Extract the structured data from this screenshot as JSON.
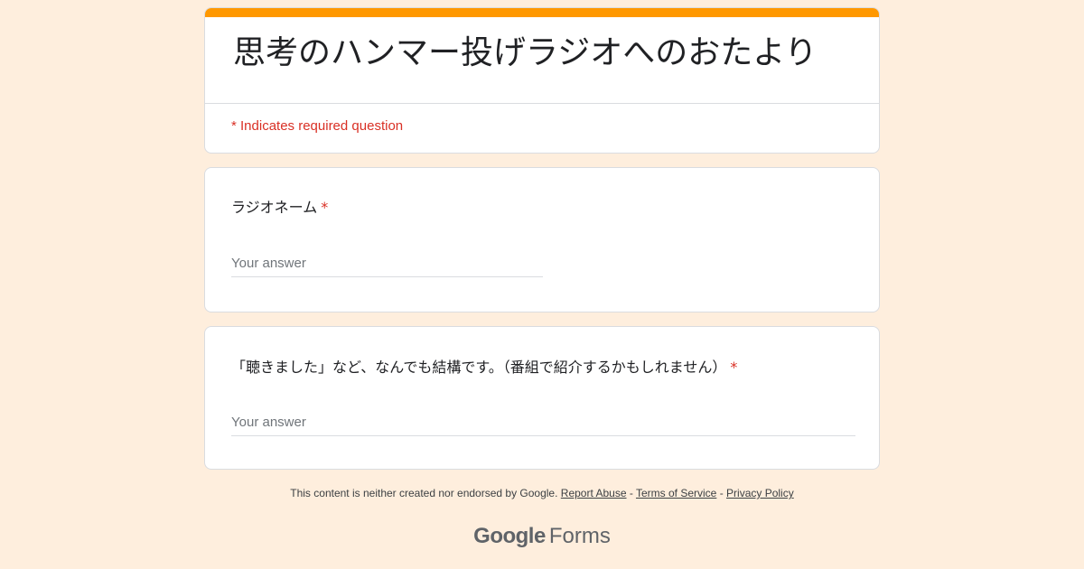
{
  "header": {
    "title": "思考のハンマー投げラジオへのおたより",
    "required_note": "* Indicates required question",
    "accent_color": "#ff9800"
  },
  "questions": [
    {
      "label": "ラジオネーム",
      "required_mark": "*",
      "placeholder": "Your answer",
      "value": ""
    },
    {
      "label": "「聴きました」など、なんでも結構です。（番組で紹介するかもしれません）",
      "required_mark": "*",
      "placeholder": "Your answer",
      "value": ""
    }
  ],
  "footer": {
    "disclaimer": "This content is neither created nor endorsed by Google.",
    "report_abuse": "Report Abuse",
    "separator": "-",
    "terms": "Terms of Service",
    "privacy": "Privacy Policy"
  },
  "brand": {
    "google": "Google",
    "forms": "Forms"
  },
  "colors": {
    "background": "#feeedd",
    "required": "#d93025"
  }
}
